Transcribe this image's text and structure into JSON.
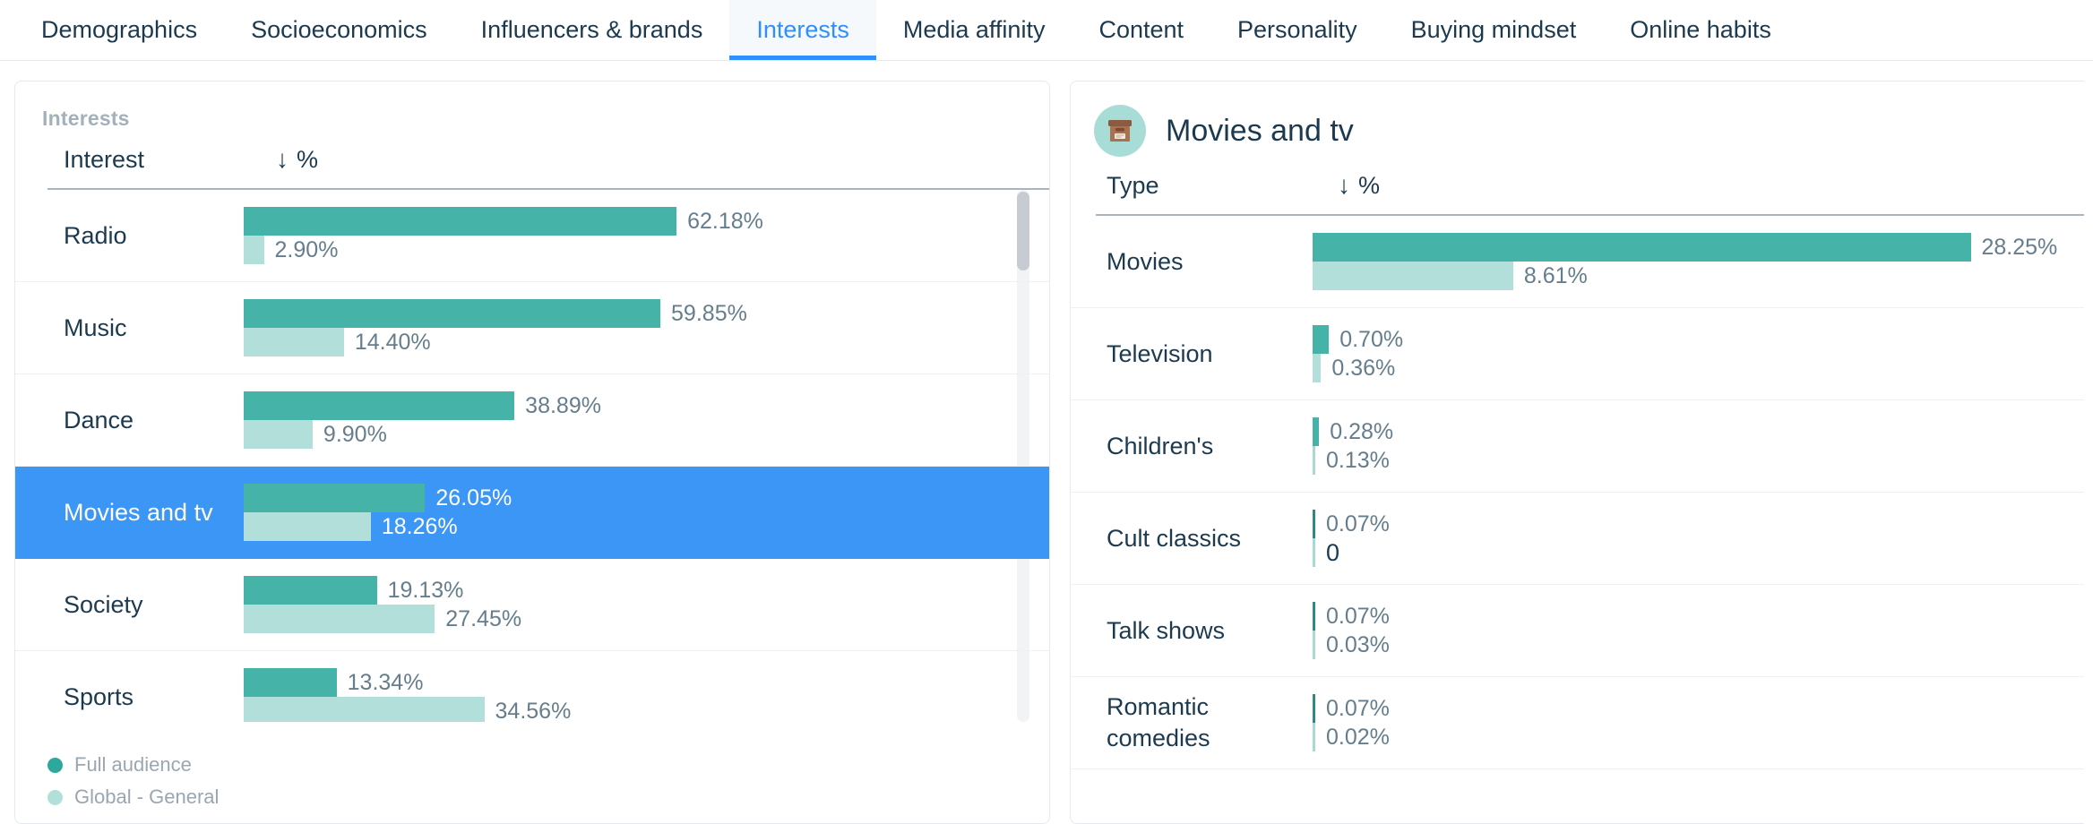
{
  "tabs": [
    {
      "label": "Demographics",
      "active": false
    },
    {
      "label": "Socioeconomics",
      "active": false
    },
    {
      "label": "Influencers & brands",
      "active": false
    },
    {
      "label": "Interests",
      "active": true
    },
    {
      "label": "Media affinity",
      "active": false
    },
    {
      "label": "Content",
      "active": false
    },
    {
      "label": "Personality",
      "active": false
    },
    {
      "label": "Buying mindset",
      "active": false
    },
    {
      "label": "Online habits",
      "active": false
    }
  ],
  "left_panel": {
    "title": "Interests",
    "col_name": "Interest",
    "sort_arrow": "↓",
    "sort_metric": "%",
    "legend": [
      {
        "label": "Full audience",
        "color": "#2fa89c"
      },
      {
        "label": "Global - General",
        "color": "#b3dfdb"
      }
    ]
  },
  "right_panel": {
    "icon": "archive-box-icon",
    "title": "Movies and tv",
    "col_name": "Type",
    "sort_arrow": "↓",
    "sort_metric": "%"
  },
  "colors": {
    "primary_bar": "#46b3a9",
    "secondary_bar": "#b3dfdb",
    "selected_row": "#3b96f5",
    "accent_tab": "#2f8fff",
    "text": "#1c3a4f"
  },
  "chart_data": [
    {
      "type": "bar",
      "title": "Interests",
      "xlabel": "",
      "ylabel": "Interest",
      "orientation": "horizontal",
      "xlim": [
        0,
        70
      ],
      "series": [
        {
          "name": "Full audience",
          "color": "#46b3a9"
        },
        {
          "name": "Global - General",
          "color": "#b3dfdb"
        }
      ],
      "categories": [
        "Radio",
        "Music",
        "Dance",
        "Movies and tv",
        "Society",
        "Sports"
      ],
      "rows": [
        {
          "label": "Radio",
          "full_audience": "62.18%",
          "global_general": "2.90%",
          "full_val": 62.18,
          "global_val": 2.9,
          "selected": false
        },
        {
          "label": "Music",
          "full_audience": "59.85%",
          "global_general": "14.40%",
          "full_val": 59.85,
          "global_val": 14.4,
          "selected": false
        },
        {
          "label": "Dance",
          "full_audience": "38.89%",
          "global_general": "9.90%",
          "full_val": 38.89,
          "global_val": 9.9,
          "selected": false
        },
        {
          "label": "Movies and tv",
          "full_audience": "26.05%",
          "global_general": "18.26%",
          "full_val": 26.05,
          "global_val": 18.26,
          "selected": true
        },
        {
          "label": "Society",
          "full_audience": "19.13%",
          "global_general": "27.45%",
          "full_val": 19.13,
          "global_val": 27.45,
          "selected": false
        },
        {
          "label": "Sports",
          "full_audience": "13.34%",
          "global_general": "34.56%",
          "full_val": 13.34,
          "global_val": 34.56,
          "selected": false
        }
      ]
    },
    {
      "type": "bar",
      "title": "Movies and tv",
      "xlabel": "",
      "ylabel": "Type",
      "orientation": "horizontal",
      "xlim": [
        0,
        30
      ],
      "series": [
        {
          "name": "Full audience",
          "color": "#46b3a9"
        },
        {
          "name": "Global - General",
          "color": "#b3dfdb"
        }
      ],
      "categories": [
        "Movies",
        "Television",
        "Children's",
        "Cult classics",
        "Talk shows",
        "Romantic comedies"
      ],
      "rows": [
        {
          "label": "Movies",
          "full_audience": "28.25%",
          "global_general": "8.61%",
          "full_val": 28.25,
          "global_val": 8.61,
          "selected": false
        },
        {
          "label": "Television",
          "full_audience": "0.70%",
          "global_general": "0.36%",
          "full_val": 0.7,
          "global_val": 0.36,
          "selected": false
        },
        {
          "label": "Children's",
          "full_audience": "0.28%",
          "global_general": "0.13%",
          "full_val": 0.28,
          "global_val": 0.13,
          "selected": false
        },
        {
          "label": "Cult classics",
          "full_audience": "0.07%",
          "global_general": "0",
          "full_val": 0.07,
          "global_val": 0.0,
          "selected": false
        },
        {
          "label": "Talk shows",
          "full_audience": "0.07%",
          "global_general": "0.03%",
          "full_val": 0.07,
          "global_val": 0.03,
          "selected": false
        },
        {
          "label": "Romantic comedies",
          "full_audience": "0.07%",
          "global_general": "0.02%",
          "full_val": 0.07,
          "global_val": 0.02,
          "selected": false
        }
      ]
    }
  ]
}
